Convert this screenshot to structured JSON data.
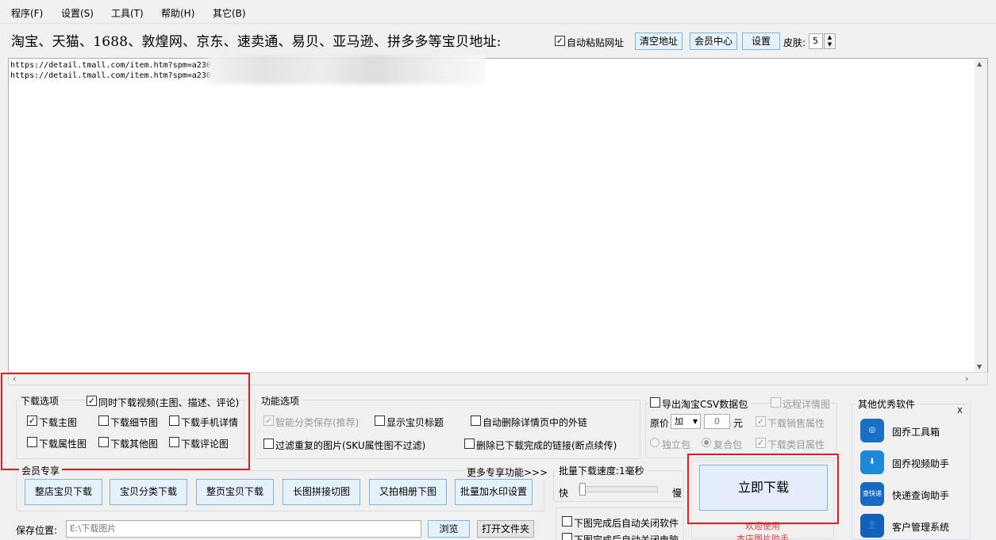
{
  "menu": [
    "程序(F)",
    "设置(S)",
    "工具(T)",
    "帮助(H)",
    "其它(B)"
  ],
  "header": {
    "title": "淘宝、天猫、1688、敦煌网、京东、速卖通、易贝、亚马逊、拼多多等宝贝地址:",
    "auto_paste_label": "自动粘贴网址",
    "clear_label": "清空地址",
    "member_label": "会员中心",
    "settings_label": "设置",
    "skin_label": "皮肤:",
    "skin_value": "5"
  },
  "urls": [
    "https://detail.tmall.com/item.htm?spm=a230",
    "https://detail.tmall.com/item.htm?spm=a230"
  ],
  "download_options": {
    "title": "下载选项",
    "video_label": "同时下载视频(主图、描述、评论)",
    "items": [
      "下载主图",
      "下载细节图",
      "下载手机详情",
      "下载属性图",
      "下载其他图",
      "下载评论图"
    ]
  },
  "function_options": {
    "title": "功能选项",
    "smart_save": "智能分类保存(推荐)",
    "show_title": "显示宝贝标题",
    "auto_delete_links": "自动删除详情页中的外链",
    "filter_dup": "过滤重复的图片(SKU属性图不过滤)",
    "delete_done": "删除已下载完成的链接(断点续传)"
  },
  "csv": {
    "export_label": "导出淘宝CSV数据包",
    "remote_detail": "远程详情图",
    "price_label": "原价",
    "price_op": "加",
    "price_value": "0",
    "unit": "元",
    "sales_attr": "下载销售属性",
    "standalone": "独立包",
    "composite": "复合包",
    "category_attr": "下载类目属性"
  },
  "member": {
    "title": "会员专享",
    "more": "更多专享功能>>>",
    "buttons": [
      "整店宝贝下载",
      "宝贝分类下载",
      "整页宝贝下载",
      "长图拼接切图",
      "又拍相册下图",
      "批量加水印设置"
    ]
  },
  "speed": {
    "title": "批量下载速度:1毫秒",
    "fast": "快",
    "slow": "慢",
    "progress": 0
  },
  "after": {
    "close_software": "下图完成后自动关闭软件",
    "close_pc": "下图完成后自动关闭电脑"
  },
  "download": {
    "button": "立即下载",
    "welcome": "欢迎使用",
    "footer": "本店图片助手"
  },
  "save": {
    "label": "保存位置:",
    "path": "E:\\下载图片",
    "browse": "浏览",
    "open_folder": "打开文件夹"
  },
  "sidebar": {
    "title": "其他优秀软件",
    "close": "X",
    "items": [
      {
        "label": "固乔工具箱",
        "icon": "toolbox-icon",
        "color": "#1a6fc4",
        "glyph": "◎"
      },
      {
        "label": "固乔视频助手",
        "icon": "video-download-icon",
        "color": "#1c8ad8",
        "glyph": "⬇"
      },
      {
        "label": "快递查询助手",
        "icon": "express-search-icon",
        "color": "#1769c2",
        "glyph": "查快递"
      },
      {
        "label": "客户管理系统",
        "icon": "customer-icon",
        "color": "#1560b8",
        "glyph": "👤"
      }
    ]
  }
}
